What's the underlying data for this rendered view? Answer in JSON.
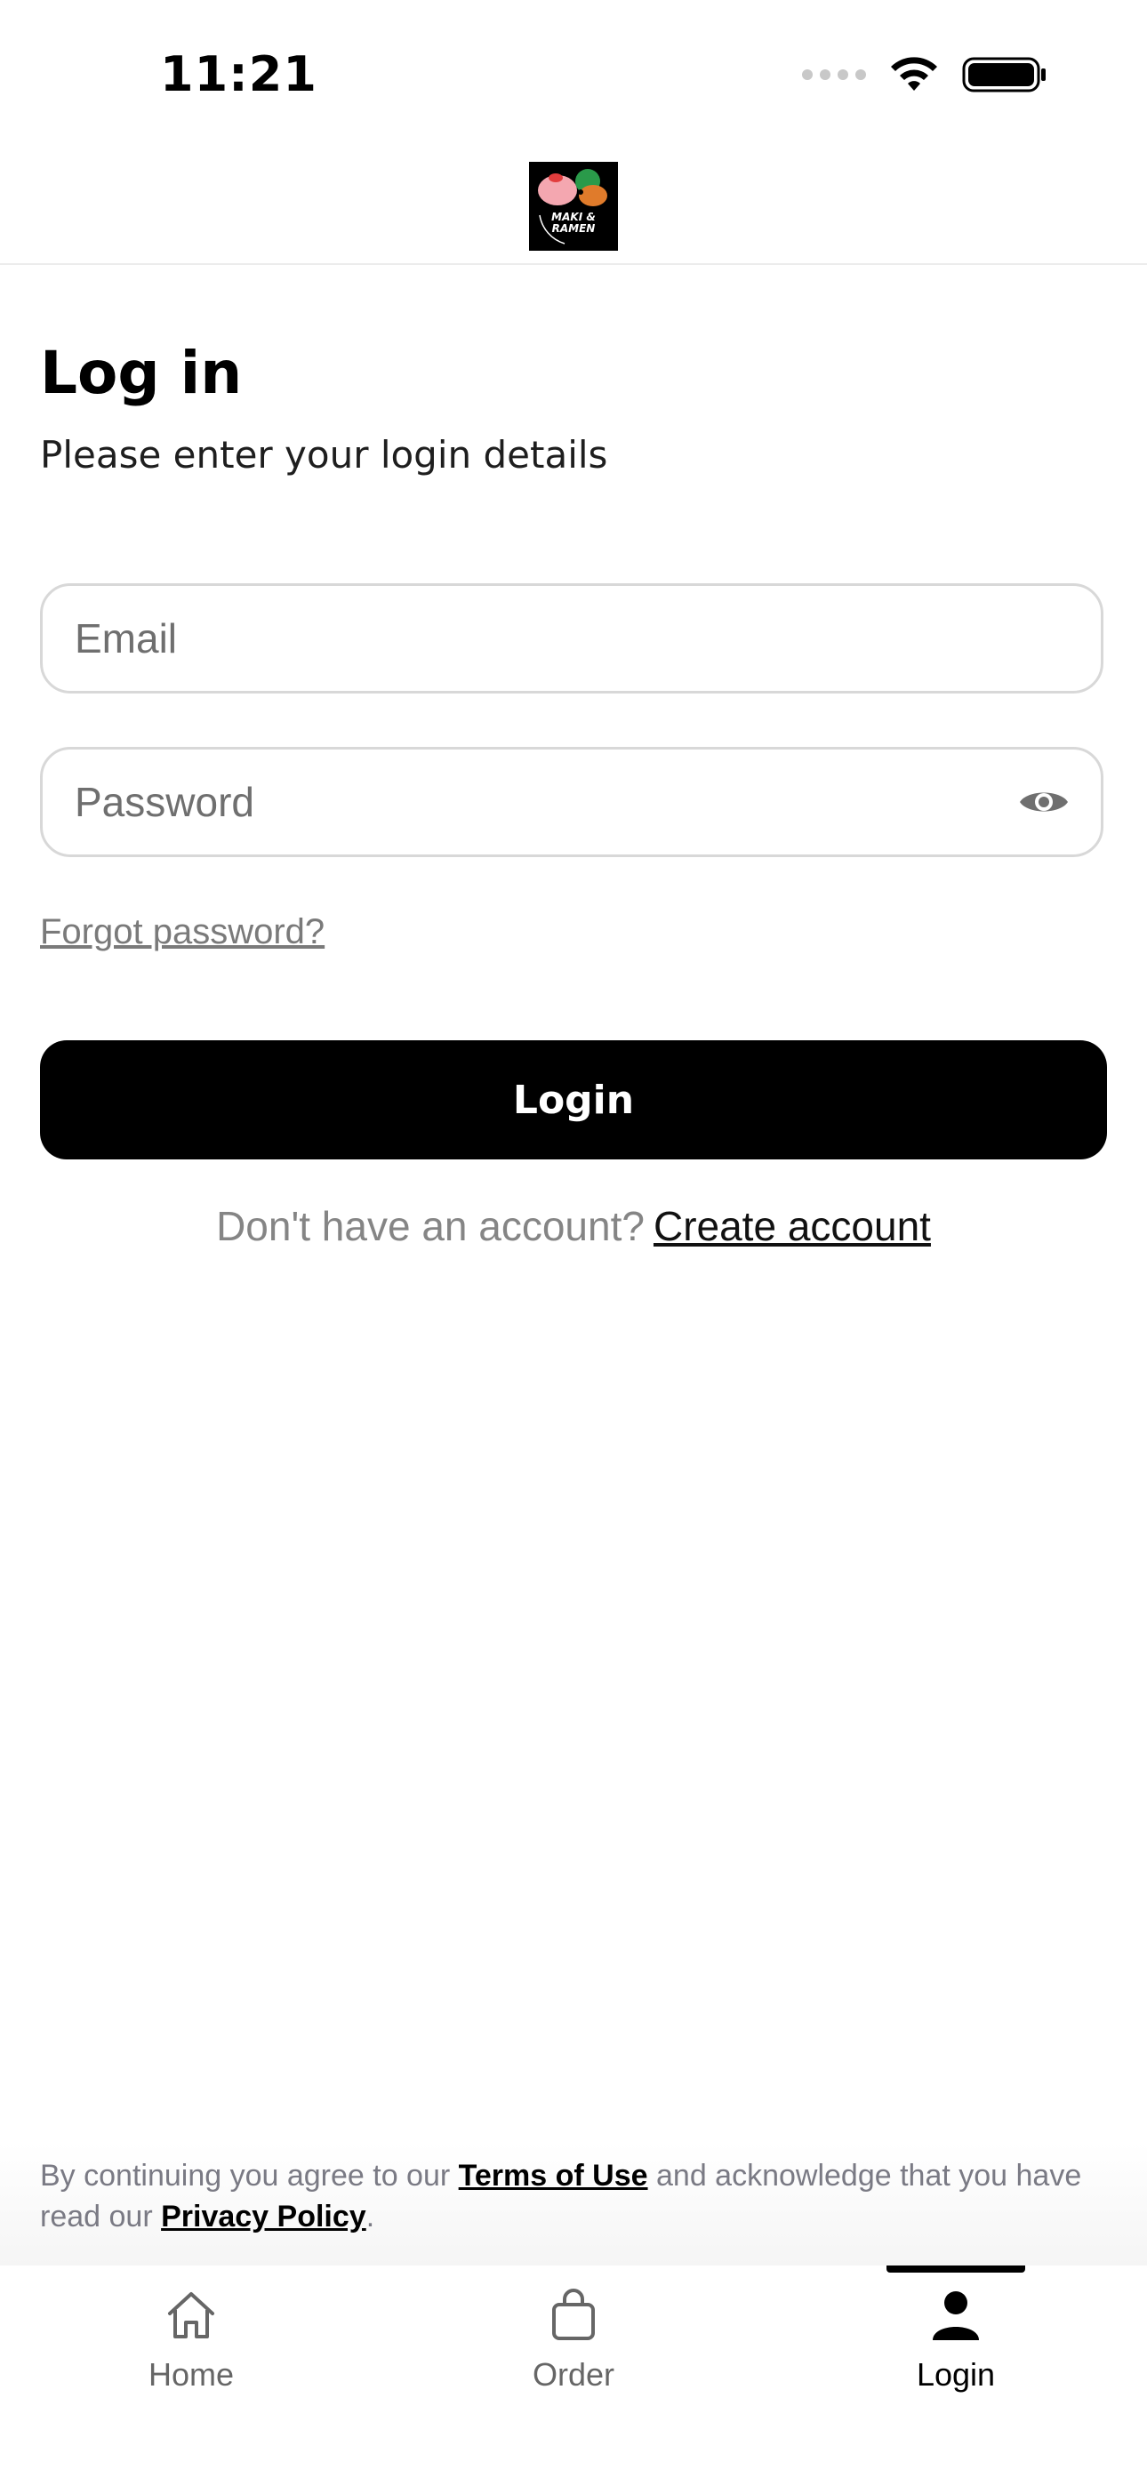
{
  "status_bar": {
    "time": "11:21"
  },
  "header": {
    "logo_text_line1": "MAKI &",
    "logo_text_line2": "RAMEN"
  },
  "login": {
    "title": "Log in",
    "subtitle": "Please enter your login details",
    "email_placeholder": "Email",
    "email_value": "",
    "password_placeholder": "Password",
    "password_value": "",
    "forgot_password_label": "Forgot password?",
    "login_button_label": "Login",
    "signup_prompt": "Don't have an account?",
    "create_account_label": "Create account"
  },
  "legal": {
    "prefix": "By continuing you agree to our",
    "terms_label": "Terms of Use",
    "middle": "and acknowledge that you have read our",
    "privacy_label": "Privacy Policy",
    "suffix": "."
  },
  "tab_bar": {
    "tabs": [
      {
        "label": "Home",
        "icon": "home-icon",
        "active": false
      },
      {
        "label": "Order",
        "icon": "bag-icon",
        "active": false
      },
      {
        "label": "Login",
        "icon": "user-icon",
        "active": true
      }
    ]
  },
  "colors": {
    "primary": "#000000",
    "background": "#ffffff",
    "muted_text": "#7a7a7a",
    "border": "#d8d8d8"
  }
}
